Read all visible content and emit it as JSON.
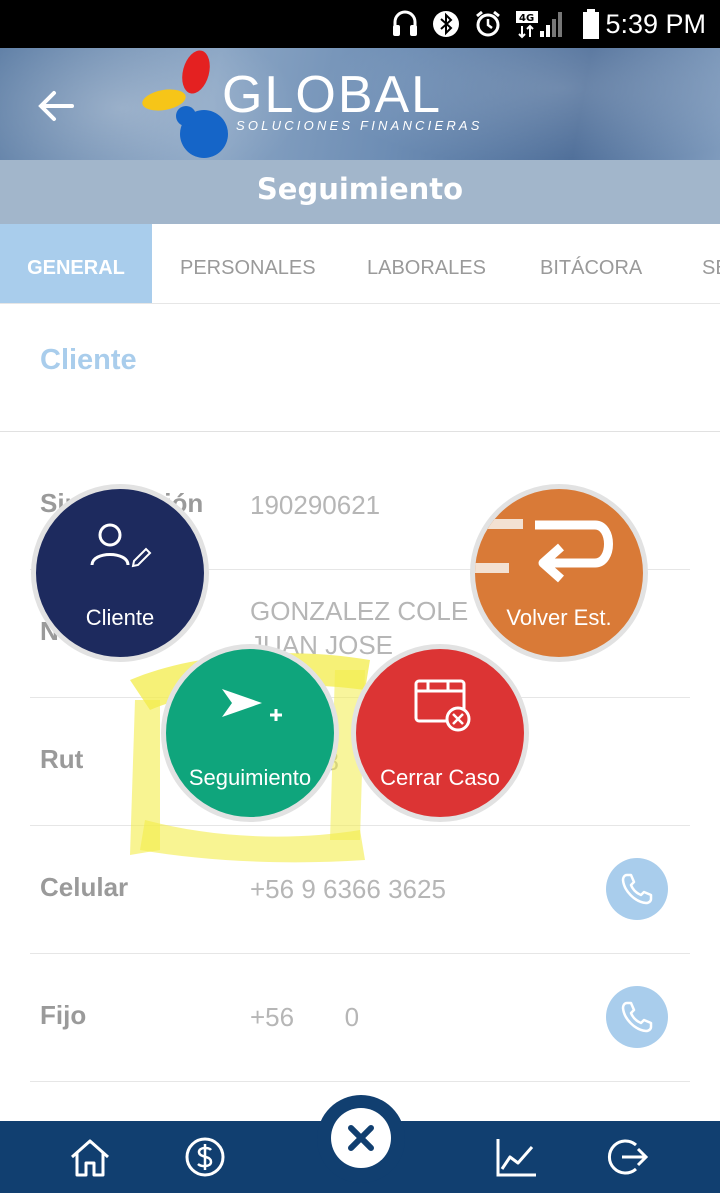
{
  "status_bar": {
    "time": "5:39 PM",
    "icons": [
      "headset-icon",
      "bluetooth-icon",
      "alarm-icon",
      "signal-4g-icon",
      "battery-icon"
    ]
  },
  "header": {
    "brand": "GLOBAL",
    "brand_subtitle": "SOLUCIONES FINANCIERAS",
    "back_icon": "arrow-left-icon"
  },
  "page": {
    "title": "Seguimiento"
  },
  "tabs": [
    {
      "label": "GENERAL",
      "active": true
    },
    {
      "label": "PERSONALES",
      "active": false
    },
    {
      "label": "LABORALES",
      "active": false
    },
    {
      "label": "BITÁCORA",
      "active": false
    },
    {
      "label": "SE",
      "active": false
    }
  ],
  "section": {
    "title": "Cliente"
  },
  "rows": [
    {
      "label": "Siniestración",
      "value": "190290621"
    },
    {
      "label": "Nombre",
      "value": "GONZALEZ COLE JUAN JOSE"
    },
    {
      "label": "Rut",
      "value": "98"
    },
    {
      "label": "Celular",
      "value": "+56 9 6366 3625"
    },
    {
      "label": "Fijo",
      "value": "+56       0"
    }
  ],
  "fabs": {
    "cliente": {
      "label": "Cliente",
      "color": "#1d2a5e"
    },
    "volver": {
      "label": "Volver Est.",
      "color": "#d97a37"
    },
    "seguimiento": {
      "label": "Seguimiento",
      "color": "#0fa57c"
    },
    "cerrar": {
      "label": "Cerrar Caso",
      "color": "#dc3434"
    }
  },
  "bottom_nav": {
    "items": [
      "home-icon",
      "dollar-icon",
      "close-icon",
      "chart-icon",
      "logout-icon"
    ],
    "background": "#113f70"
  },
  "colors": {
    "accent": "#a9cdec",
    "title_bar": "#a2b6cb"
  }
}
